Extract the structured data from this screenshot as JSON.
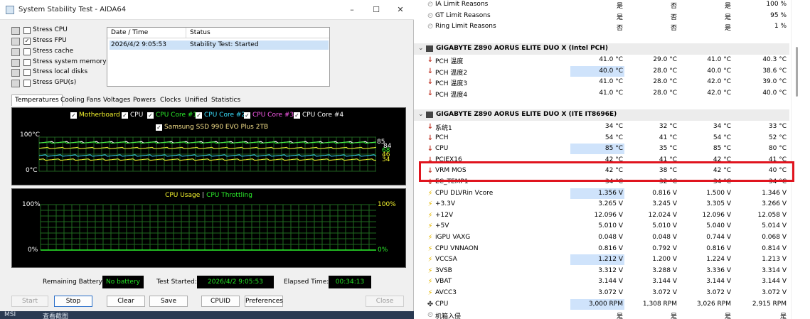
{
  "window": {
    "title": "System Stability Test - AIDA64"
  },
  "window_controls": {
    "minimize": "–",
    "maximize": "☐",
    "close": "✕"
  },
  "stress": [
    {
      "label": "Stress CPU",
      "checked": false,
      "icon": "cpu-icon"
    },
    {
      "label": "Stress FPU",
      "checked": true,
      "icon": "fpu-icon"
    },
    {
      "label": "Stress cache",
      "checked": false,
      "icon": "cache-icon"
    },
    {
      "label": "Stress system memory",
      "checked": false,
      "icon": "memory-icon"
    },
    {
      "label": "Stress local disks",
      "checked": false,
      "icon": "disk-icon"
    },
    {
      "label": "Stress GPU(s)",
      "checked": false,
      "icon": "monitor-icon"
    }
  ],
  "log": {
    "headers": [
      "Date / Time",
      "Status"
    ],
    "rows": [
      {
        "time": "2026/4/2 9:05:53",
        "status": "Stability Test: Started"
      }
    ]
  },
  "tabs": [
    "Temperatures",
    "Cooling Fans",
    "Voltages",
    "Powers",
    "Clocks",
    "Unified",
    "Statistics"
  ],
  "temp_graph": {
    "legend": [
      {
        "label": "Motherboard",
        "color": "#f5f52e"
      },
      {
        "label": "CPU",
        "color": "#ffffff"
      },
      {
        "label": "CPU Core #1",
        "color": "#2cf02c"
      },
      {
        "label": "CPU Core #2",
        "color": "#3ae0ff"
      },
      {
        "label": "CPU Core #3",
        "color": "#ff5cf0"
      },
      {
        "label": "CPU Core #4",
        "color": "#ffffff"
      },
      {
        "label": "Samsung SSD 990 EVO Plus 2TB",
        "color": "#f5e08a"
      }
    ],
    "y_top": "100°C",
    "y_bottom": "0°C",
    "right_values": [
      "85",
      "84",
      "68",
      "46",
      "34"
    ]
  },
  "cpu_graph": {
    "title_a": "CPU Usage",
    "sep": "|",
    "title_b": "CPU Throttling",
    "y_top": "100%",
    "y_bottom": "0%",
    "r_top": "100%",
    "r_bottom": "0%"
  },
  "status": {
    "battery_label": "Remaining Battery:",
    "battery_value": "No battery",
    "started_label": "Test Started:",
    "started_value": "2026/4/2 9:05:53",
    "elapsed_label": "Elapsed Time:",
    "elapsed_value": "00:34:13"
  },
  "buttons": {
    "start": "Start",
    "stop": "Stop",
    "clear": "Clear",
    "save": "Save",
    "cpuid": "CPUID",
    "preferences": "Preferences",
    "close": "Close"
  },
  "desktop": {
    "left": "MSI",
    "mid": "查看截图"
  },
  "sensors": {
    "top_rows": [
      {
        "name": "IA Limit Reasons",
        "v": [
          "是",
          "否",
          "是",
          "100 %"
        ]
      },
      {
        "name": "GT Limit Reasons",
        "v": [
          "是",
          "否",
          "是",
          "95 %"
        ]
      },
      {
        "name": "Ring Limit Reasons",
        "v": [
          "否",
          "否",
          "是",
          "1 %"
        ]
      }
    ],
    "group1": "GIGABYTE Z890 AORUS ELITE DUO X (Intel PCH)",
    "pch_rows": [
      {
        "name": "PCH 温度",
        "v": [
          "41.0 °C",
          "29.0 °C",
          "41.0 °C",
          "40.3 °C"
        ]
      },
      {
        "name": "PCH 温度2",
        "v": [
          "40.0 °C",
          "28.0 °C",
          "40.0 °C",
          "38.6 °C"
        ]
      },
      {
        "name": "PCH 温度3",
        "v": [
          "41.0 °C",
          "28.0 °C",
          "42.0 °C",
          "39.0 °C"
        ]
      },
      {
        "name": "PCH 温度4",
        "v": [
          "41.0 °C",
          "28.0 °C",
          "42.0 °C",
          "40.0 °C"
        ]
      }
    ],
    "group2": "GIGABYTE Z890 AORUS ELITE DUO X (ITE IT8696E)",
    "ite_rows": [
      {
        "name": "系统1",
        "v": [
          "34 °C",
          "32 °C",
          "34 °C",
          "33 °C"
        ]
      },
      {
        "name": "PCH",
        "v": [
          "54 °C",
          "41 °C",
          "54 °C",
          "52 °C"
        ]
      },
      {
        "name": "CPU",
        "v": [
          "85 °C",
          "35 °C",
          "85 °C",
          "80 °C"
        ]
      },
      {
        "name": "PCIEX16",
        "v": [
          "42 °C",
          "41 °C",
          "42 °C",
          "41 °C"
        ]
      },
      {
        "name": "VRM MOS",
        "v": [
          "42 °C",
          "38 °C",
          "42 °C",
          "40 °C"
        ]
      },
      {
        "name": "EC_TEMP1",
        "v": [
          "34 °C",
          "32 °C",
          "34 °C",
          "34 °C"
        ]
      },
      {
        "name": "CPU DLVRin Vcore",
        "v": [
          "1.356 V",
          "0.816 V",
          "1.500 V",
          "1.346 V"
        ]
      },
      {
        "name": "+3.3V",
        "v": [
          "3.265 V",
          "3.245 V",
          "3.305 V",
          "3.266 V"
        ]
      },
      {
        "name": "+12V",
        "v": [
          "12.096 V",
          "12.024 V",
          "12.096 V",
          "12.058 V"
        ]
      },
      {
        "name": "+5V",
        "v": [
          "5.010 V",
          "5.010 V",
          "5.040 V",
          "5.014 V"
        ]
      },
      {
        "name": "iGPU VAXG",
        "v": [
          "0.048 V",
          "0.048 V",
          "0.744 V",
          "0.068 V"
        ]
      },
      {
        "name": "CPU VNNAON",
        "v": [
          "0.816 V",
          "0.792 V",
          "0.816 V",
          "0.814 V"
        ]
      },
      {
        "name": "VCCSA",
        "v": [
          "1.212 V",
          "1.200 V",
          "1.224 V",
          "1.213 V"
        ]
      },
      {
        "name": "3VSB",
        "v": [
          "3.312 V",
          "3.288 V",
          "3.336 V",
          "3.314 V"
        ]
      },
      {
        "name": "VBAT",
        "v": [
          "3.144 V",
          "3.144 V",
          "3.144 V",
          "3.144 V"
        ]
      },
      {
        "name": "AVCC3",
        "v": [
          "3.072 V",
          "3.072 V",
          "3.072 V",
          "3.072 V"
        ]
      },
      {
        "name": "CPU",
        "v": [
          "3,000 RPM",
          "1,308 RPM",
          "3,026 RPM",
          "2,915 RPM"
        ]
      },
      {
        "name": "机箱入侵",
        "v": [
          "是",
          "是",
          "是",
          "是"
        ]
      }
    ]
  }
}
